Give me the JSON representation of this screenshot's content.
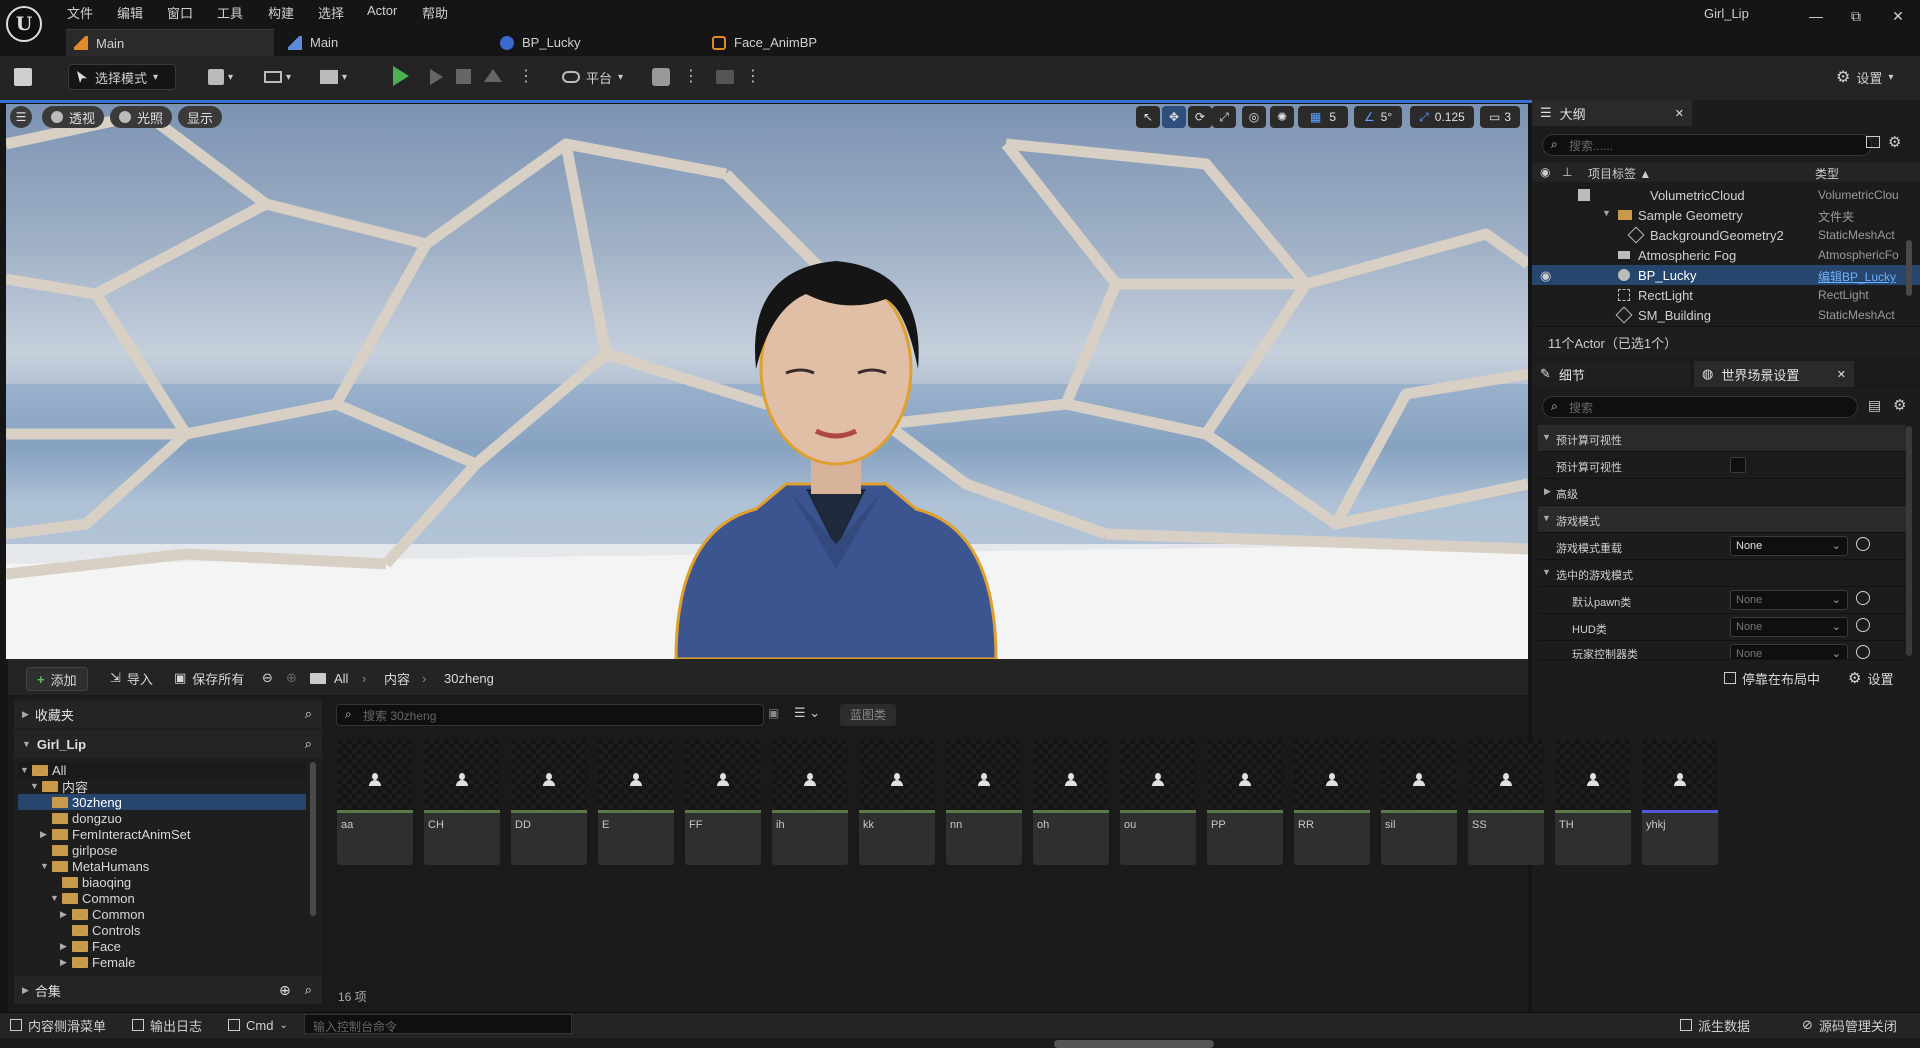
{
  "window": {
    "title": "Girl_Lip",
    "buttons": {
      "minimize": "—",
      "restore": "⧉",
      "close": "✕"
    }
  },
  "menu": [
    "文件",
    "编辑",
    "窗口",
    "工具",
    "构建",
    "选择",
    "Actor",
    "帮助"
  ],
  "tabs": [
    {
      "label": "Main",
      "icon": "level-icon",
      "active": true
    },
    {
      "label": "Main",
      "icon": "level-icon",
      "active": false
    },
    {
      "label": "BP_Lucky",
      "icon": "blueprint-icon",
      "active": false
    },
    {
      "label": "Face_AnimBP",
      "icon": "anim-blueprint-icon",
      "active": false
    }
  ],
  "toolbar": {
    "mode": "选择模式",
    "platform": "平台",
    "settings": "设置"
  },
  "viewport": {
    "perspective": "透视",
    "lighting": "光照",
    "show": "显示",
    "grid_snap": "5",
    "rotation_snap": "5°",
    "scale_snap": "0.125",
    "camera_speed": "3"
  },
  "outliner": {
    "title": "大纲",
    "search_placeholder": "搜索......",
    "col_label": "项目标签 ▲",
    "col_type": "类型",
    "rows": [
      {
        "name": "VolumetricCloud",
        "type": "VolumetricClou"
      },
      {
        "name": "Sample Geometry",
        "type": "文件夹"
      },
      {
        "name": "BackgroundGeometry2",
        "type": "StaticMeshAct"
      },
      {
        "name": "Atmospheric Fog",
        "type": "AtmosphericFo"
      },
      {
        "name": "BP_Lucky",
        "type": "编辑BP_Lucky"
      },
      {
        "name": "RectLight",
        "type": "RectLight"
      },
      {
        "name": "SM_Building",
        "type": "StaticMeshAct"
      }
    ],
    "count": "11个Actor（已选1个）"
  },
  "details": {
    "tab_details": "细节",
    "tab_world": "世界场景设置",
    "search_placeholder": "搜索",
    "rows": [
      {
        "label": "预计算可视性",
        "kind": "cat"
      },
      {
        "label": "预计算可视性",
        "kind": "check"
      },
      {
        "label": "高级",
        "kind": "cat-collapsed"
      },
      {
        "label": "游戏模式",
        "kind": "cat"
      },
      {
        "label": "游戏模式重载",
        "kind": "combo",
        "value": "None"
      },
      {
        "label": "选中的游戏模式",
        "kind": "subcat"
      },
      {
        "label": "默认pawn类",
        "kind": "combo-dis",
        "value": "None"
      },
      {
        "label": "HUD类",
        "kind": "combo-dis",
        "value": "None"
      },
      {
        "label": "玩家控制器类",
        "kind": "combo-dis",
        "value": "None"
      }
    ]
  },
  "content_browser": {
    "add": "添加",
    "import": "导入",
    "save_all": "保存所有",
    "breadcrumb": [
      "All",
      "内容",
      "30zheng"
    ],
    "dock": "停靠在布局中",
    "settings": "设置",
    "favorites": "收藏夹",
    "project": "Girl_Lip",
    "collections": "合集",
    "search_placeholder": "搜索 30zheng",
    "filter_chip": "蓝图类",
    "item_count": "16 项",
    "tree": [
      {
        "label": "All",
        "depth": 0,
        "open": true
      },
      {
        "label": "内容",
        "depth": 1,
        "open": true
      },
      {
        "label": "30zheng",
        "depth": 2,
        "selected": true
      },
      {
        "label": "dongzuo",
        "depth": 2
      },
      {
        "label": "FemInteractAnimSet",
        "depth": 2,
        "collapsed": true
      },
      {
        "label": "girlpose",
        "depth": 2
      },
      {
        "label": "MetaHumans",
        "depth": 2,
        "open": true
      },
      {
        "label": "biaoqing",
        "depth": 3
      },
      {
        "label": "Common",
        "depth": 3,
        "open": true
      },
      {
        "label": "Common",
        "depth": 4,
        "collapsed": true
      },
      {
        "label": "Controls",
        "depth": 4
      },
      {
        "label": "Face",
        "depth": 4,
        "collapsed": true
      },
      {
        "label": "Female",
        "depth": 4,
        "collapsed": true
      }
    ],
    "assets": [
      "aa",
      "CH",
      "DD",
      "E",
      "FF",
      "ih",
      "kk",
      "nn",
      "oh",
      "ou",
      "PP",
      "RR",
      "sil",
      "SS",
      "TH",
      "yhkj"
    ]
  },
  "statusbar": {
    "content_drawer": "内容侧滑菜单",
    "output_log": "输出日志",
    "cmd": "Cmd",
    "console_placeholder": "输入控制台命令",
    "derived_data": "派生数据",
    "source_control": "源码管理关闭"
  }
}
